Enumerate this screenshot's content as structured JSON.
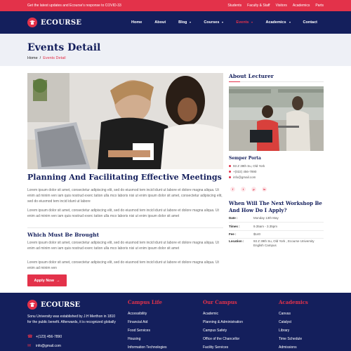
{
  "topbar": {
    "message": "Get the latest updates and Ecourse's response to COVID-33",
    "links": [
      "Students",
      "Faculty & Staff",
      "Visitors",
      "Academics",
      "Parts"
    ]
  },
  "nav": {
    "brand": "ECOURSE",
    "menu": [
      {
        "label": "Home",
        "dropdown": false,
        "active": false
      },
      {
        "label": "About",
        "dropdown": false,
        "active": false
      },
      {
        "label": "Blog",
        "dropdown": true,
        "active": false
      },
      {
        "label": "Courses",
        "dropdown": true,
        "active": false
      },
      {
        "label": "Events",
        "dropdown": true,
        "active": true
      },
      {
        "label": "Academics",
        "dropdown": true,
        "active": false
      },
      {
        "label": "Contact",
        "dropdown": false,
        "active": false
      }
    ]
  },
  "page_header": {
    "title": "Events Detail",
    "breadcrumb_home": "Home",
    "breadcrumb_sep": "/",
    "breadcrumb_current": "Events Detail"
  },
  "main": {
    "title": "Planning And Facilitating Effective Meetings",
    "para1": "Lorem ipsum dolor sit amet, consectetur adipiscing elit, sed do eiusmod tem incid idunt ut labore et dolore magna aliqua. Ut enim ad minim ven iam quis nostrud exerc tation ulla mco laboris nisi ut enim ipsum dolor sit amet, consectetur adipiscing elit, sed do eiusmod tem incid idunt ut labore",
    "para2": "Lorem ipsum dolor sit amet, consectetur adipiscing elit, sed do eiusmod tem incid idunt ut labore et dolore magna aliqua. Ut enim ad minim ven iam quis nostrud exerc tation ulla mco laboris nisi ut enim ipsum dolor sit amet",
    "subtitle": "Which Must Be Brought",
    "para3": "Lorem ipsum dolor sit amet, consectetur adipiscing elit, sed do eiusmod tem incid idunt ut labore et dolore magna aliqua. Ut enim ad minim ven iam quis nostrud exerc tation ulla mco laboris nisi ut enim ipsum dolor sit amet",
    "para4": "Lorem ipsum dolor sit amet, consectetur adipiscing elit, sed do eiusmod tem incid idunt ut labore et dolore magna aliqua. Ut enim ad minim ven",
    "apply_label": "Apply Now",
    "apply_arrow": "→"
  },
  "sidebar": {
    "lecturer_heading": "About Lecturer",
    "lecturer_name": "Semper Porta",
    "lecturer_address": "93 Z 39th Su, Old York",
    "lecturer_phone": "+(022) 456-7890",
    "lecturer_email": "info@gmail.com",
    "social_icons": [
      "facebook-icon",
      "twitter-icon",
      "pinterest-icon",
      "linkedin-icon"
    ],
    "social_glyphs": [
      "f",
      "t",
      "p",
      "in"
    ],
    "workshop_heading": "When Will The Next Workshop Be And How Do I Apply?",
    "info": [
      {
        "label": "Date :",
        "value": "Monday 13th May"
      },
      {
        "label": "Times :",
        "value": "9.35am - 3.35pm"
      },
      {
        "label": "Fee :",
        "value": "$140"
      },
      {
        "label": "Location :",
        "value": "93 Z 39th Su, Old York , Ecourse University English Campus"
      }
    ]
  },
  "footer": {
    "brand": "ECOURSE",
    "about": "Sonu University was established by J.H Merthon in 1810 for the public benefit. Afterwards, it is recognized globally",
    "phone": "+(123) 456-7890",
    "email": "info@gmail.com",
    "columns": [
      {
        "title": "Campus Life",
        "items": [
          "Accessibility",
          "Financial Aid",
          "Food Services",
          "Housing",
          "Information Technologies"
        ]
      },
      {
        "title": "Our Campus",
        "items": [
          "Academic",
          "Planning & Administration",
          "Campus Safety",
          "Office of the Chancellor",
          "Facility Services"
        ]
      },
      {
        "title": "Academics",
        "items": [
          "Canvas",
          "Catalyst",
          "Library",
          "Time Schedule",
          "Admissions"
        ]
      }
    ]
  },
  "colors": {
    "accent": "#e3324a",
    "navy": "#141f5c",
    "header_bg": "#eef0f6"
  }
}
